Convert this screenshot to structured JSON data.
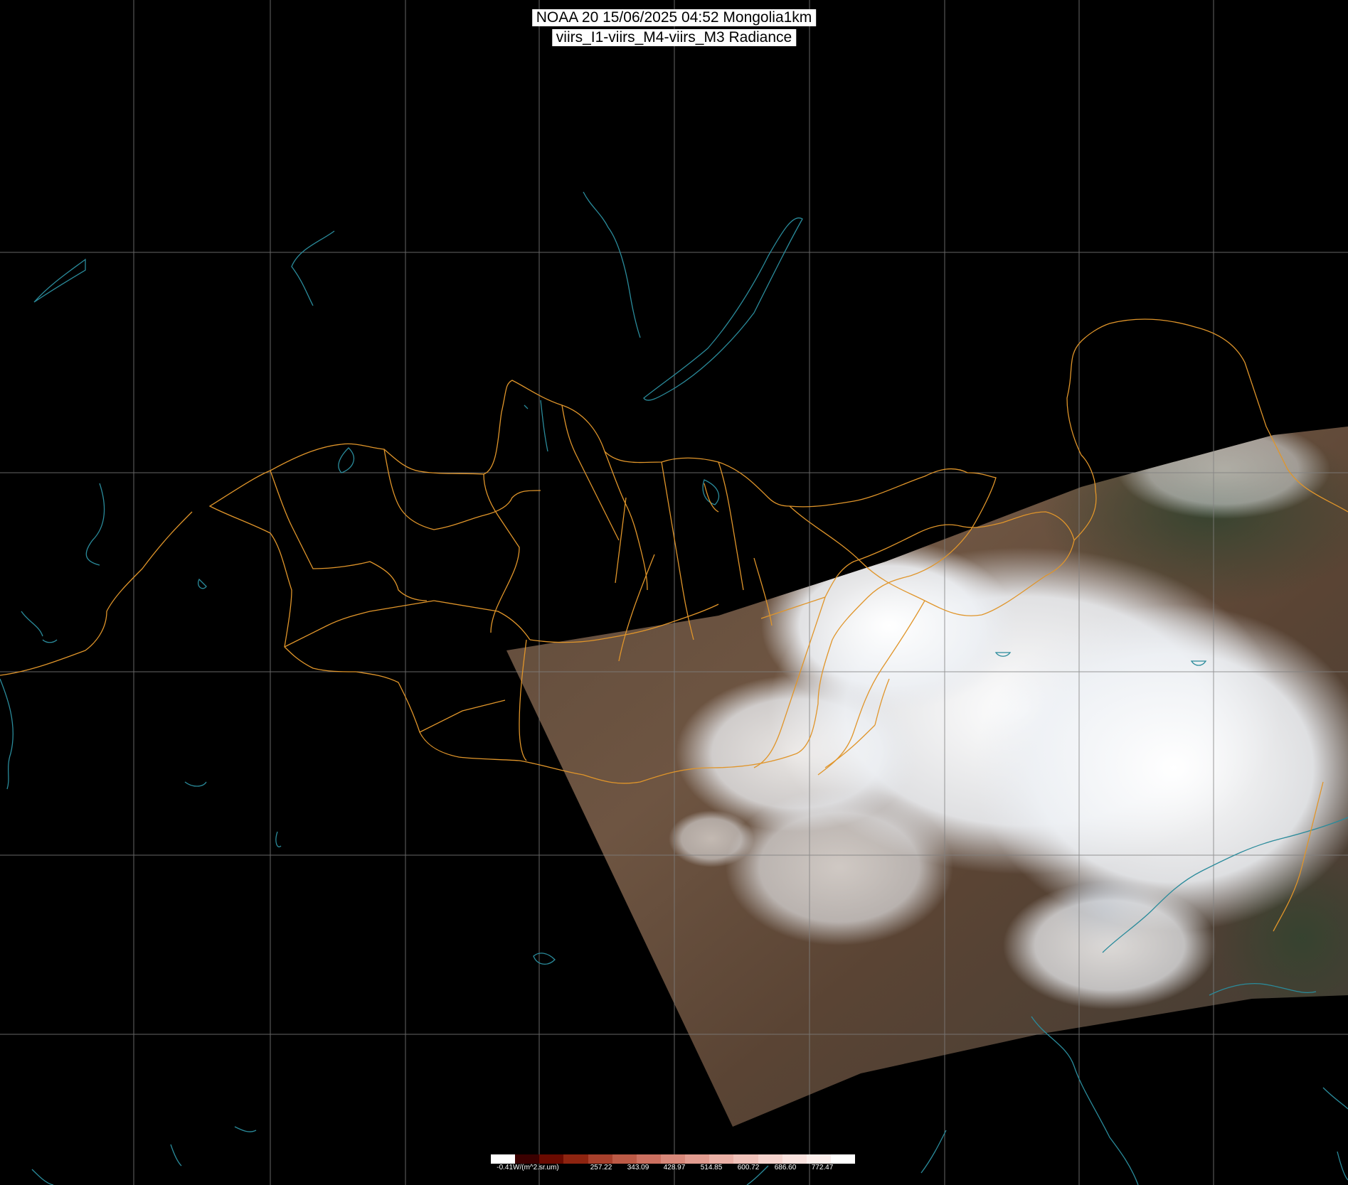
{
  "title": {
    "line1": "NOAA 20 15/06/2025 04:52 Mongolia1km",
    "line2": "viirs_I1-viirs_M4-viirs_M3 Radiance"
  },
  "colors": {
    "background": "#000000",
    "graticule": "#808080",
    "borders": "#e0952a",
    "coastlines": "#2a8b9b",
    "cloud": "#f2f4f7",
    "land_brown": "#6b5340",
    "land_green": "#3d4a34"
  },
  "colorbar": {
    "unit_label": "-0.41W/(m^2.sr.um)",
    "ticks": [
      "257.22",
      "343.09",
      "428.97",
      "514.85",
      "600.72",
      "686.60",
      "772.47"
    ],
    "colors": [
      "#ffffff",
      "#3a0000",
      "#6a0a00",
      "#8e2410",
      "#a8402c",
      "#bc5a46",
      "#cc7060",
      "#d8887a",
      "#e29c90",
      "#eab0a6",
      "#f0c2ba",
      "#f5d3cd",
      "#f9e2de",
      "#fcefec",
      "#ffffff"
    ]
  }
}
